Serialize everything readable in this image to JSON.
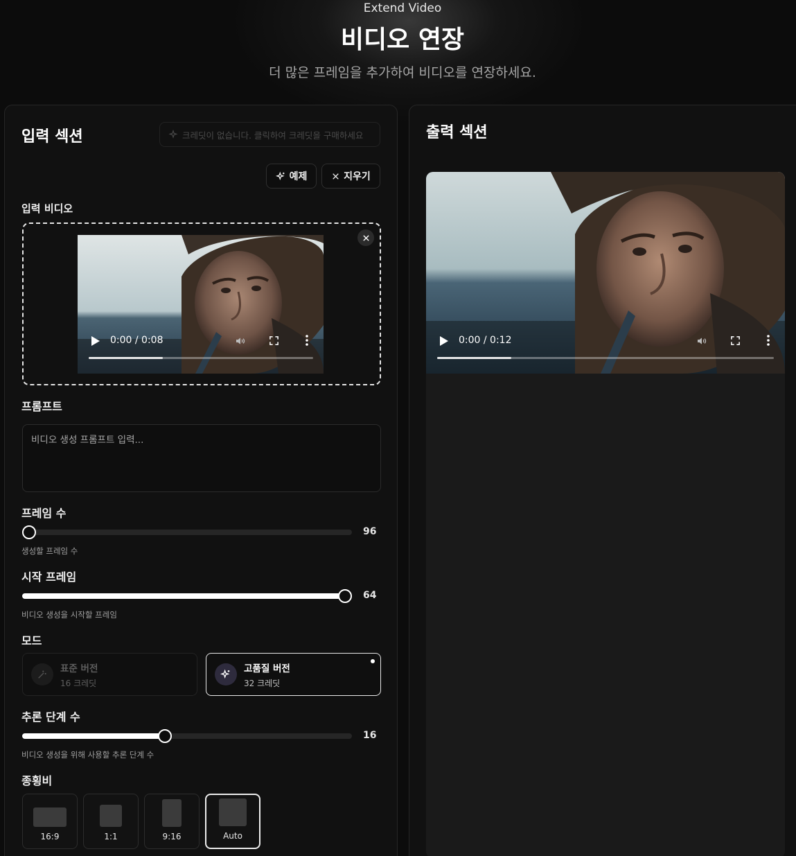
{
  "header": {
    "eyebrow": "Extend Video",
    "title": "비디오 연장",
    "subtitle": "더 많은 프레임을 추가하여 비디오를 연장하세요."
  },
  "input": {
    "section_title": "입력 섹션",
    "credit_notice": "크레딧이 없습니다. 클릭하여 크레딧을 구매하세요",
    "example_button": "예제",
    "clear_button": "지우기",
    "video_label": "입력 비디오",
    "video": {
      "time": "0:00 / 0:08",
      "progress": 0.33
    },
    "prompt_label": "프롬프트",
    "prompt_placeholder": "비디오 생성 프롬프트 입력...",
    "frames": {
      "label": "프레임 수",
      "value": "96",
      "hint": "생성할 프레임 수",
      "fraction": 0.0
    },
    "start_frame": {
      "label": "시작 프레임",
      "value": "64",
      "hint": "비디오 생성을 시작할 프레임",
      "fraction": 1.0
    },
    "mode": {
      "label": "모드",
      "options": [
        {
          "name": "표준 버전",
          "credits": "16 크레딧",
          "selected": false
        },
        {
          "name": "고품질 버전",
          "credits": "32 크레딧",
          "selected": true
        }
      ]
    },
    "steps": {
      "label": "추론 단계 수",
      "value": "16",
      "hint": "비디오 생성을 위해 사용할 추론 단계 수",
      "fraction": 0.43
    },
    "aspect": {
      "label": "종횡비",
      "options": [
        {
          "label": "16:9",
          "selected": false
        },
        {
          "label": "1:1",
          "selected": false
        },
        {
          "label": "9:16",
          "selected": false
        },
        {
          "label": "Auto",
          "selected": true
        }
      ]
    }
  },
  "output": {
    "section_title": "출력 섹션",
    "video": {
      "time": "0:00 / 0:12",
      "progress": 0.22
    }
  },
  "icons": [
    "sparkle-icon",
    "close-icon",
    "play-icon",
    "volume-icon",
    "fullscreen-icon",
    "more-options-icon",
    "wand-icon"
  ]
}
